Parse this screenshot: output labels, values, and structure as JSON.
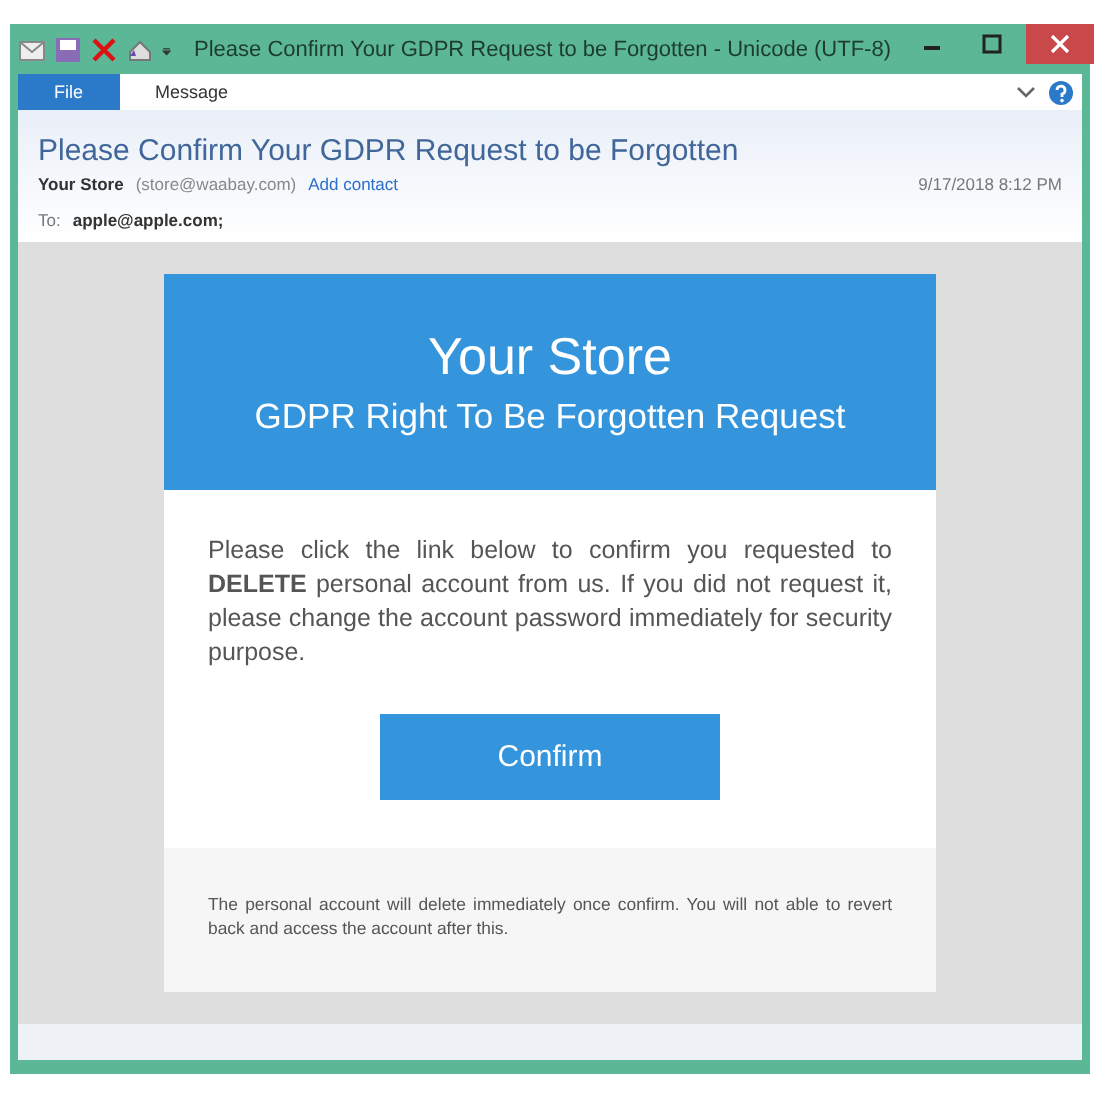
{
  "window": {
    "title": "Please Confirm Your GDPR Request to be Forgotten - Unicode (UTF-8)"
  },
  "tabs": [
    {
      "label": "File",
      "selected": true
    },
    {
      "label": "Message",
      "selected": false
    }
  ],
  "header": {
    "subject": "Please Confirm Your GDPR Request to be Forgotten",
    "sender_name": "Your Store",
    "sender_address": "(store@waabay.com)",
    "add_contact": "Add contact",
    "date": "9/17/2018 8:12 PM",
    "to_label": "To:",
    "to": "apple@apple.com;"
  },
  "email": {
    "brand": "Your Store",
    "heading": "GDPR Right To Be Forgotten Request",
    "message": "Please click the link below to confirm you requested to **DELETE** personal account from us. If you did not request it, please change the account password immediately for security purpose.",
    "button": "Confirm",
    "footer": "The personal account will delete immediately once confirm. You will not able to revert back and access the account after this."
  }
}
